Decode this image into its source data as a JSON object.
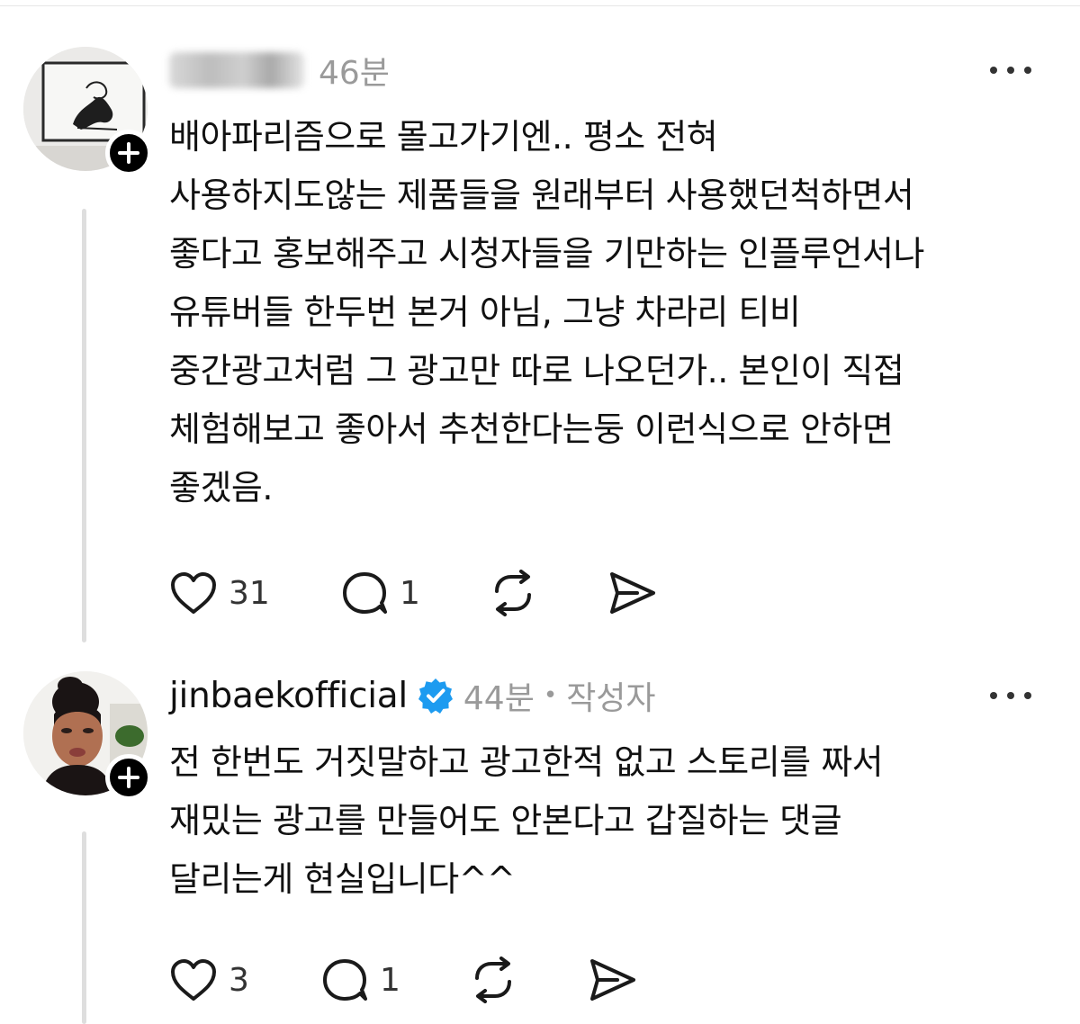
{
  "comments": [
    {
      "username": "",
      "time": "46분",
      "author_tag": "",
      "verified": false,
      "lines": [
        "배아파리즘으로 몰고가기엔.. 평소 전혀",
        "사용하지도않는 제품들을 원래부터 사용했던척하면서",
        "좋다고 홍보해주고 시청자들을 기만하는 인플루언서나",
        "유튜버들 한두번 본거 아님, 그냥 차라리 티비",
        "중간광고처럼  그 광고만 따로 나오던가.. 본인이 직접",
        "체험해보고 좋아서 추천한다는둥 이런식으로 안하면",
        "좋겠음."
      ],
      "likes": "31",
      "replies": "1"
    },
    {
      "username": "jinbaekofficial",
      "time": "44분",
      "separator": "•",
      "author_tag": "작성자",
      "verified": true,
      "lines": [
        "전 한번도 거짓말하고 광고한적 없고 스토리를 짜서",
        "재밌는 광고를 만들어도 안본다고 갑질하는 댓글",
        "달리는게 현실입니다^^"
      ],
      "likes": "3",
      "replies": "1"
    }
  ],
  "icons": {
    "like": "heart-icon",
    "reply": "comment-icon",
    "repost": "repost-icon",
    "share": "send-icon",
    "more": "more-icon",
    "follow": "plus-icon",
    "verified": "verified-badge-icon"
  },
  "colors": {
    "verified": "#1d9bf0",
    "meta": "#9a9a9a",
    "thread_line": "#dedede"
  }
}
